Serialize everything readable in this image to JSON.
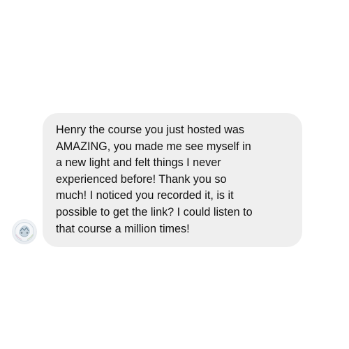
{
  "conversation": {
    "message": {
      "text": "Henry the course you just hosted was\nAMAZING, you made me see myself in\na new light and felt things I never\nexperienced before! Thank you so\nmuch! I noticed you recorded it, is it\npossible to get the link? I could listen to\nthat course a million times!"
    },
    "sender": {
      "avatar_icon": "profile-avatar"
    }
  },
  "colors": {
    "background": "#ffffff",
    "bubble": "#efefef",
    "text": "#111111"
  }
}
